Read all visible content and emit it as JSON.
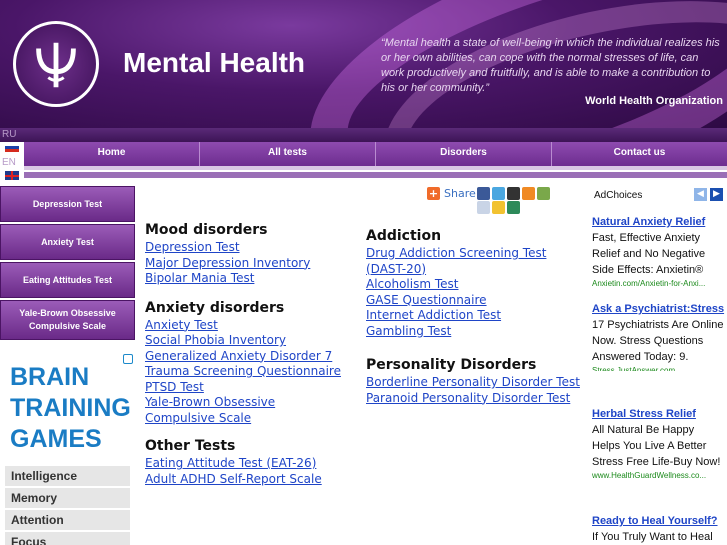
{
  "header": {
    "site_title": "Mental Health",
    "quote": "“Mental health a state of well-being in which the individual realizes his or her own abilities, can cope with the normal stresses of life, can work productively and fruitfully, and is able to make a contribution to his or her community.”",
    "quote_source": "World Health Organization"
  },
  "lang": {
    "ru": "RU",
    "en": "EN"
  },
  "nav": [
    {
      "label": "Home"
    },
    {
      "label": "All tests"
    },
    {
      "label": "Disorders"
    },
    {
      "label": "Contact us"
    }
  ],
  "left_menu": [
    {
      "label": "Depression Test"
    },
    {
      "label": "Anxiety Test"
    },
    {
      "label": "Eating Attitudes Test"
    },
    {
      "label": "Yale-Brown Obsessive Compulsive Scale"
    }
  ],
  "brain_ad": {
    "title": "BRAIN TRAINING GAMES",
    "items": [
      "Intelligence",
      "Memory",
      "Attention",
      "Focus"
    ]
  },
  "share": {
    "label": "Share"
  },
  "sections_left": [
    {
      "heading": "Mood disorders",
      "links": [
        "Depression Test",
        "Major Depression Inventory",
        "Bipolar Mania Test"
      ]
    },
    {
      "heading": "Anxiety disorders",
      "links": [
        "Anxiety Test",
        "Social Phobia Inventory",
        "Generalized Anxiety Disorder 7",
        "Trauma Screening Questionnaire",
        "PTSD Test",
        "Yale-Brown Obsessive Compulsive Scale"
      ]
    },
    {
      "heading": "Other Tests",
      "links": [
        "Eating Attitude Test (EAT-26)",
        "Adult ADHD Self-Report Scale"
      ]
    }
  ],
  "sections_right": [
    {
      "heading": "Addiction",
      "links": [
        "Drug Addiction Screening Test (DAST-20)",
        "Alcoholism Test",
        "GASE Questionnaire",
        "Internet Addiction Test",
        "Gambling Test"
      ]
    },
    {
      "heading": "Personality Disorders",
      "links": [
        "Borderline Personality Disorder Test",
        "Paranoid Personality Disorder Test"
      ]
    }
  ],
  "right_ads": {
    "adchoices": "AdChoices",
    "items": [
      {
        "title": "Natural Anxiety Relief",
        "body": "Fast, Effective Anxiety Relief and No Negative Side Effects: Anxietin®",
        "url": "Anxietin.com/Anxietin-for-Anxi..."
      },
      {
        "title": "Ask a Psychiatrist:Stress",
        "body": "17 Psychiatrists Are Online Now. Stress Questions Answered Today: 9.",
        "url": "Stress.JustAnswer.com"
      },
      {
        "title": "Herbal Stress Relief",
        "body": "All Natural Be Happy Helps You Live A Better Stress Free Life-Buy Now!",
        "url": "www.HealthGuardWellness.co..."
      },
      {
        "title": "Ready to Heal Yourself?",
        "body": "If You Truly Want to Heal",
        "url": ""
      }
    ]
  }
}
